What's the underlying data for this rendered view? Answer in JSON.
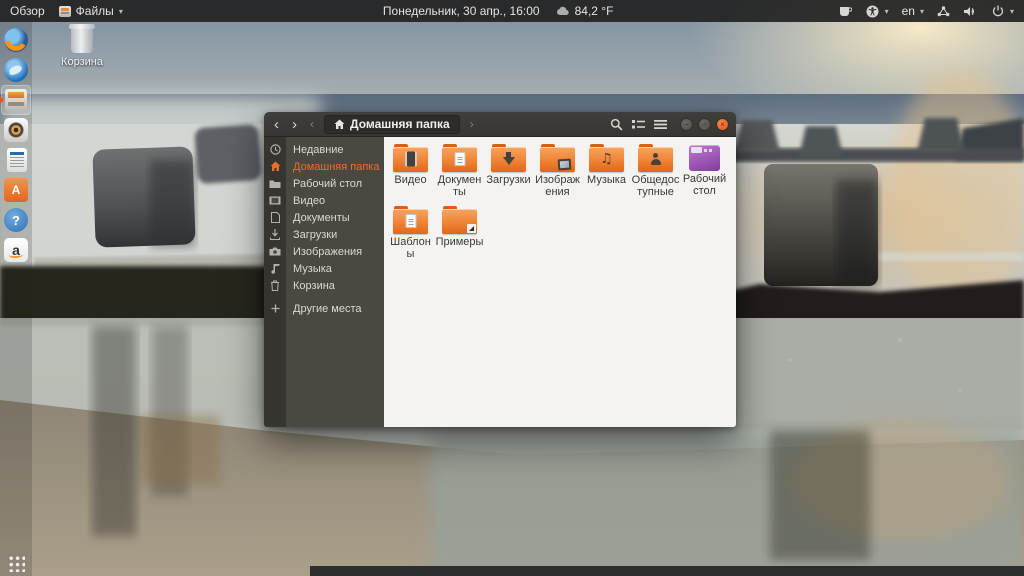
{
  "topbar": {
    "overview_label": "Обзор",
    "app_menu_label": "Файлы",
    "clock": "Понедельник, 30 апр., 16:00",
    "temperature": "84,2 °F",
    "language": "en",
    "right_icons": [
      "caffeine-cup-icon",
      "accessibility-icon",
      "keyboard-layout",
      "network-icon",
      "volume-icon",
      "power-icon"
    ]
  },
  "dock": {
    "items": [
      {
        "name": "firefox"
      },
      {
        "name": "thunderbird"
      },
      {
        "name": "files",
        "active": true
      },
      {
        "name": "rhythmbox"
      },
      {
        "name": "libreoffice-writer"
      },
      {
        "name": "ubuntu-software"
      },
      {
        "name": "help"
      },
      {
        "name": "amazon"
      },
      {
        "name": "show-applications"
      }
    ]
  },
  "desktop": {
    "trash_label": "Корзина"
  },
  "window": {
    "headerbar": {
      "back": "‹",
      "forward": "›",
      "path_prev": "‹",
      "path_next": "›",
      "path_label": "Домашняя папка",
      "icons": [
        "search-icon",
        "view-toggle-icon",
        "menu-icon"
      ],
      "controls": {
        "minimize": "−",
        "maximize": "▫",
        "close": "×"
      }
    },
    "sidebar": {
      "items": [
        {
          "label": "Недавние",
          "icon": "recent"
        },
        {
          "label": "Домашняя папка",
          "icon": "home",
          "selected": true
        },
        {
          "label": "Рабочий стол",
          "icon": "folder"
        },
        {
          "label": "Видео",
          "icon": "video"
        },
        {
          "label": "Документы",
          "icon": "document"
        },
        {
          "label": "Загрузки",
          "icon": "download"
        },
        {
          "label": "Изображения",
          "icon": "pictures"
        },
        {
          "label": "Музыка",
          "icon": "music"
        },
        {
          "label": "Корзина",
          "icon": "trash"
        },
        {
          "label": "Другие места",
          "icon": "plus"
        }
      ]
    },
    "files": [
      {
        "label": "Видео",
        "type": "video"
      },
      {
        "label": "Документы",
        "type": "documents"
      },
      {
        "label": "Загрузки",
        "type": "downloads"
      },
      {
        "label": "Изображения",
        "type": "pictures"
      },
      {
        "label": "Музыка",
        "type": "music"
      },
      {
        "label": "Общедоступные",
        "type": "public"
      },
      {
        "label": "Рабочий стол",
        "type": "desktop"
      },
      {
        "label": "Шаблоны",
        "type": "templates"
      },
      {
        "label": "Примеры",
        "type": "examples-link"
      }
    ]
  },
  "colors": {
    "accent_orange": "#e95420",
    "selected_sidebar_text": "#ec6c2c",
    "folder_orange": "#ef8335",
    "desktop_icon_purple": "#9a54b4",
    "headerbar": "#3b3935",
    "sidebar": "#4a4841",
    "content_bg": "#f4f3f0",
    "topbar_bg": "#222222",
    "close_button": "#e4571f"
  }
}
